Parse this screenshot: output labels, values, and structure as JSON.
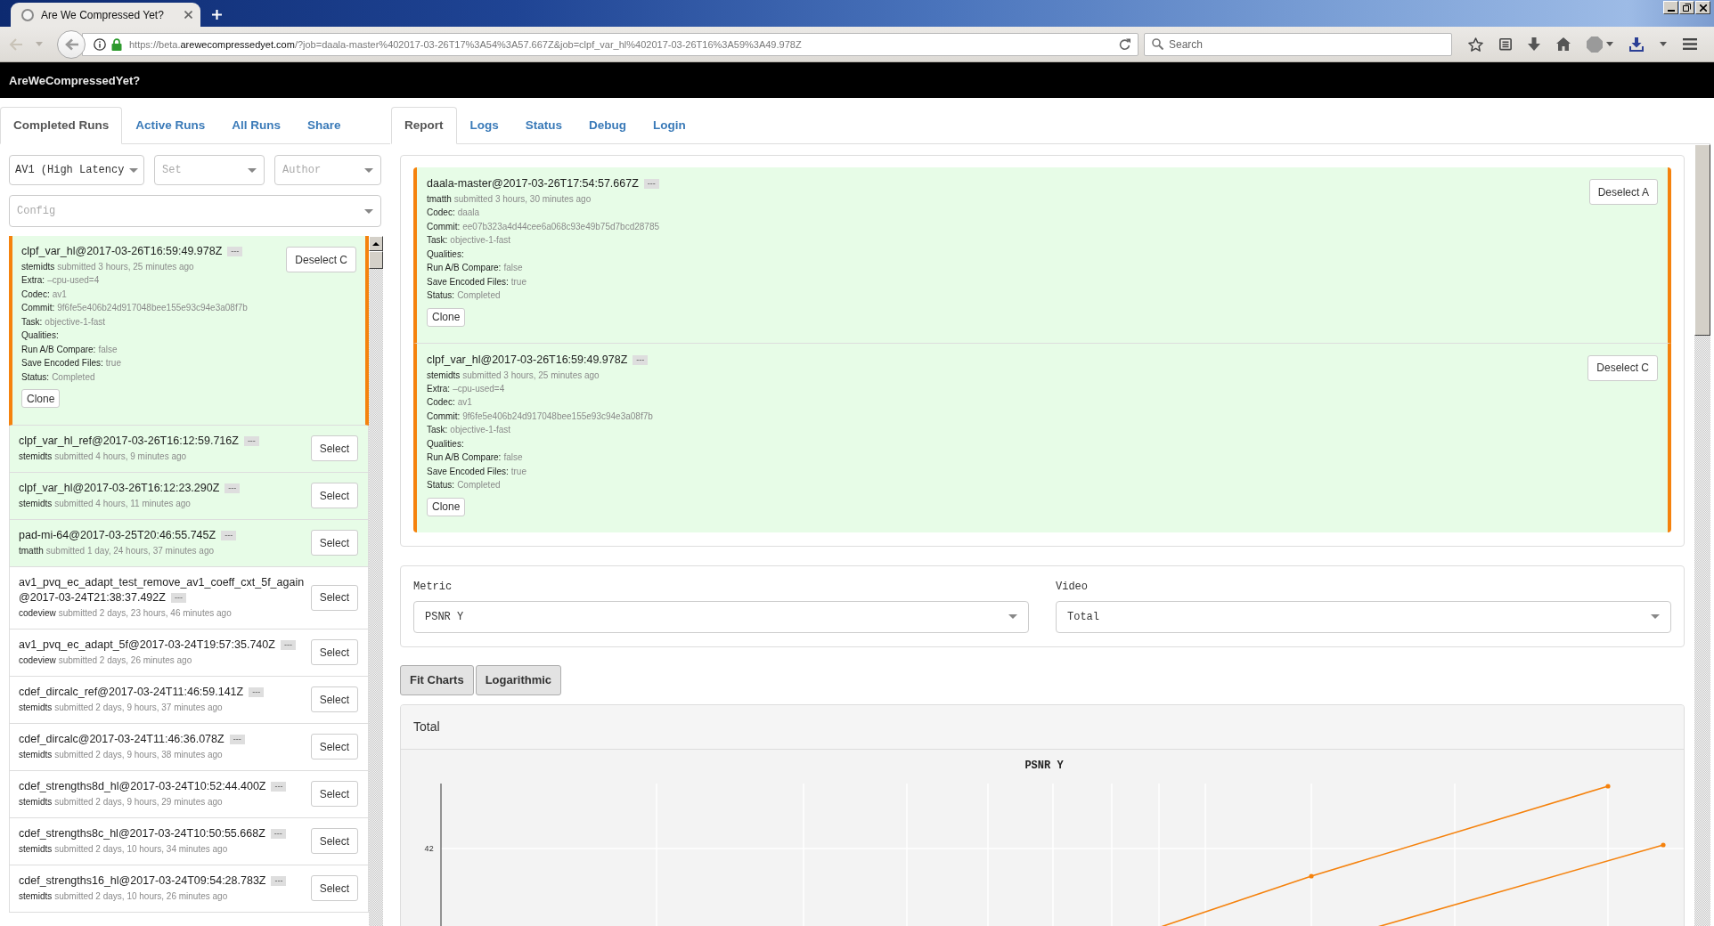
{
  "browser": {
    "tab_title": "Are We Compressed Yet?",
    "url": {
      "prefix": "https://beta.",
      "domain": "arewecompressedyet.com",
      "rest": "/?job=daala-master%402017-03-26T17%3A54%3A57.667Z&job=clpf_var_hl%402017-03-26T16%3A59%3A49.978Z"
    },
    "search": {
      "placeholder": "Search"
    }
  },
  "app": {
    "title": "AreWeCompressedYet?"
  },
  "left_tabs": [
    {
      "label": "Completed Runs",
      "selected": true
    },
    {
      "label": "Active Runs",
      "selected": false
    },
    {
      "label": "All Runs",
      "selected": false
    },
    {
      "label": "Share",
      "selected": false
    }
  ],
  "filters": [
    {
      "value": "AV1 (High Latency"
    },
    {
      "placeholder": "Set"
    },
    {
      "placeholder": "Author"
    }
  ],
  "config": {
    "placeholder": "Config"
  },
  "runs": [
    {
      "name": "clpf_var_hl@2017-03-26T16:59:49.978Z",
      "tag": "---",
      "author": "stemidts",
      "submitted": "submitted 3 hours, 25 minutes ago",
      "selected": true,
      "highlighted": true,
      "details": [
        {
          "label": "Extra:",
          "value": "–cpu-used=4"
        },
        {
          "label": "Codec:",
          "value": "av1"
        },
        {
          "label": "Commit:",
          "value": "9f6fe5e406b24d917048bee155e93c94e3a08f7b"
        },
        {
          "label": "Task:",
          "value": "objective-1-fast"
        },
        {
          "label": "Qualities:"
        },
        {
          "label": "Run A/B Compare:",
          "value": "false"
        },
        {
          "label": "Save Encoded Files:",
          "value": "true"
        },
        {
          "label": "Status:",
          "value": "Completed"
        }
      ],
      "clone": "Clone",
      "button": "Deselect C"
    },
    {
      "name": "clpf_var_hl_ref@2017-03-26T16:12:59.716Z",
      "tag": "---",
      "author": "stemidts",
      "submitted": "submitted 4 hours, 9 minutes ago",
      "selected": false,
      "highlighted": true,
      "button": "Select"
    },
    {
      "name": "clpf_var_hl@2017-03-26T16:12:23.290Z",
      "tag": "---",
      "author": "stemidts",
      "submitted": "submitted 4 hours, 11 minutes ago",
      "selected": false,
      "highlighted": true,
      "button": "Select"
    },
    {
      "name": "pad-mi-64@2017-03-25T20:46:55.745Z",
      "tag": "---",
      "author": "tmatth",
      "submitted": "submitted 1 day, 24 hours, 37 minutes ago",
      "selected": false,
      "highlighted": true,
      "button": "Select"
    },
    {
      "name": "av1_pvq_ec_adapt_test_remove_av1_coeff_cxt_5f_again@2017-03-24T21:38:37.492Z",
      "tag": "---",
      "author": "codeview",
      "submitted": "submitted 2 days, 23 hours, 46 minutes ago",
      "selected": false,
      "highlighted": false,
      "button": "Select"
    },
    {
      "name": "av1_pvq_ec_adapt_5f@2017-03-24T19:57:35.740Z",
      "tag": "---",
      "author": "codeview",
      "submitted": "submitted 2 days, 26 minutes ago",
      "selected": false,
      "highlighted": false,
      "button": "Select"
    },
    {
      "name": "cdef_dircalc_ref@2017-03-24T11:46:59.141Z",
      "tag": "---",
      "author": "stemidts",
      "submitted": "submitted 2 days, 9 hours, 37 minutes ago",
      "selected": false,
      "highlighted": false,
      "button": "Select"
    },
    {
      "name": "cdef_dircalc@2017-03-24T11:46:36.078Z",
      "tag": "---",
      "author": "stemidts",
      "submitted": "submitted 2 days, 9 hours, 38 minutes ago",
      "selected": false,
      "highlighted": false,
      "button": "Select"
    },
    {
      "name": "cdef_strengths8d_hl@2017-03-24T10:52:44.400Z",
      "tag": "---",
      "author": "stemidts",
      "submitted": "submitted 2 days, 9 hours, 29 minutes ago",
      "selected": false,
      "highlighted": false,
      "button": "Select"
    },
    {
      "name": "cdef_strengths8c_hl@2017-03-24T10:50:55.668Z",
      "tag": "---",
      "author": "stemidts",
      "submitted": "submitted 2 days, 10 hours, 34 minutes ago",
      "selected": false,
      "highlighted": false,
      "button": "Select"
    },
    {
      "name": "cdef_strengths16_hl@2017-03-24T09:54:28.783Z",
      "tag": "---",
      "author": "stemidts",
      "submitted": "submitted 2 days, 10 hours, 26 minutes ago",
      "selected": false,
      "highlighted": false,
      "button": "Select"
    }
  ],
  "right_tabs": [
    {
      "label": "Report",
      "selected": true
    },
    {
      "label": "Logs",
      "selected": false
    },
    {
      "label": "Status",
      "selected": false
    },
    {
      "label": "Debug",
      "selected": false
    },
    {
      "label": "Login",
      "selected": false
    }
  ],
  "report": {
    "runs": [
      {
        "name": "daala-master@2017-03-26T17:54:57.667Z",
        "tag": "---",
        "author": "tmatth",
        "submitted": "submitted 3 hours, 30 minutes ago",
        "details": [
          {
            "label": "Codec:",
            "value": "daala"
          },
          {
            "label": "Commit:",
            "value": "ee07b323a4d44cee6a068c93e49b75d7bcd28785"
          },
          {
            "label": "Task:",
            "value": "objective-1-fast"
          },
          {
            "label": "Qualities:"
          },
          {
            "label": "Run A/B Compare:",
            "value": "false"
          },
          {
            "label": "Save Encoded Files:",
            "value": "true"
          },
          {
            "label": "Status:",
            "value": "Completed"
          }
        ],
        "clone": "Clone",
        "button": "Deselect A"
      },
      {
        "name": "clpf_var_hl@2017-03-26T16:59:49.978Z",
        "tag": "---",
        "author": "stemidts",
        "submitted": "submitted 3 hours, 25 minutes ago",
        "details": [
          {
            "label": "Extra:",
            "value": "–cpu-used=4"
          },
          {
            "label": "Codec:",
            "value": "av1"
          },
          {
            "label": "Commit:",
            "value": "9f6fe5e406b24d917048bee155e93c94e3a08f7b"
          },
          {
            "label": "Task:",
            "value": "objective-1-fast"
          },
          {
            "label": "Qualities:"
          },
          {
            "label": "Run A/B Compare:",
            "value": "false"
          },
          {
            "label": "Save Encoded Files:",
            "value": "true"
          },
          {
            "label": "Status:",
            "value": "Completed"
          }
        ],
        "clone": "Clone",
        "button": "Deselect C"
      }
    ]
  },
  "metric_panel": {
    "fields": [
      {
        "label": "Metric",
        "value": "PSNR Y"
      },
      {
        "label": "Video",
        "value": "Total"
      }
    ]
  },
  "chart_buttons": [
    "Fit Charts",
    "Logarithmic"
  ],
  "chart_panel": {
    "title": "Total",
    "chart": {
      "title": "PSNR Y",
      "y_tick_label": "42"
    }
  }
}
